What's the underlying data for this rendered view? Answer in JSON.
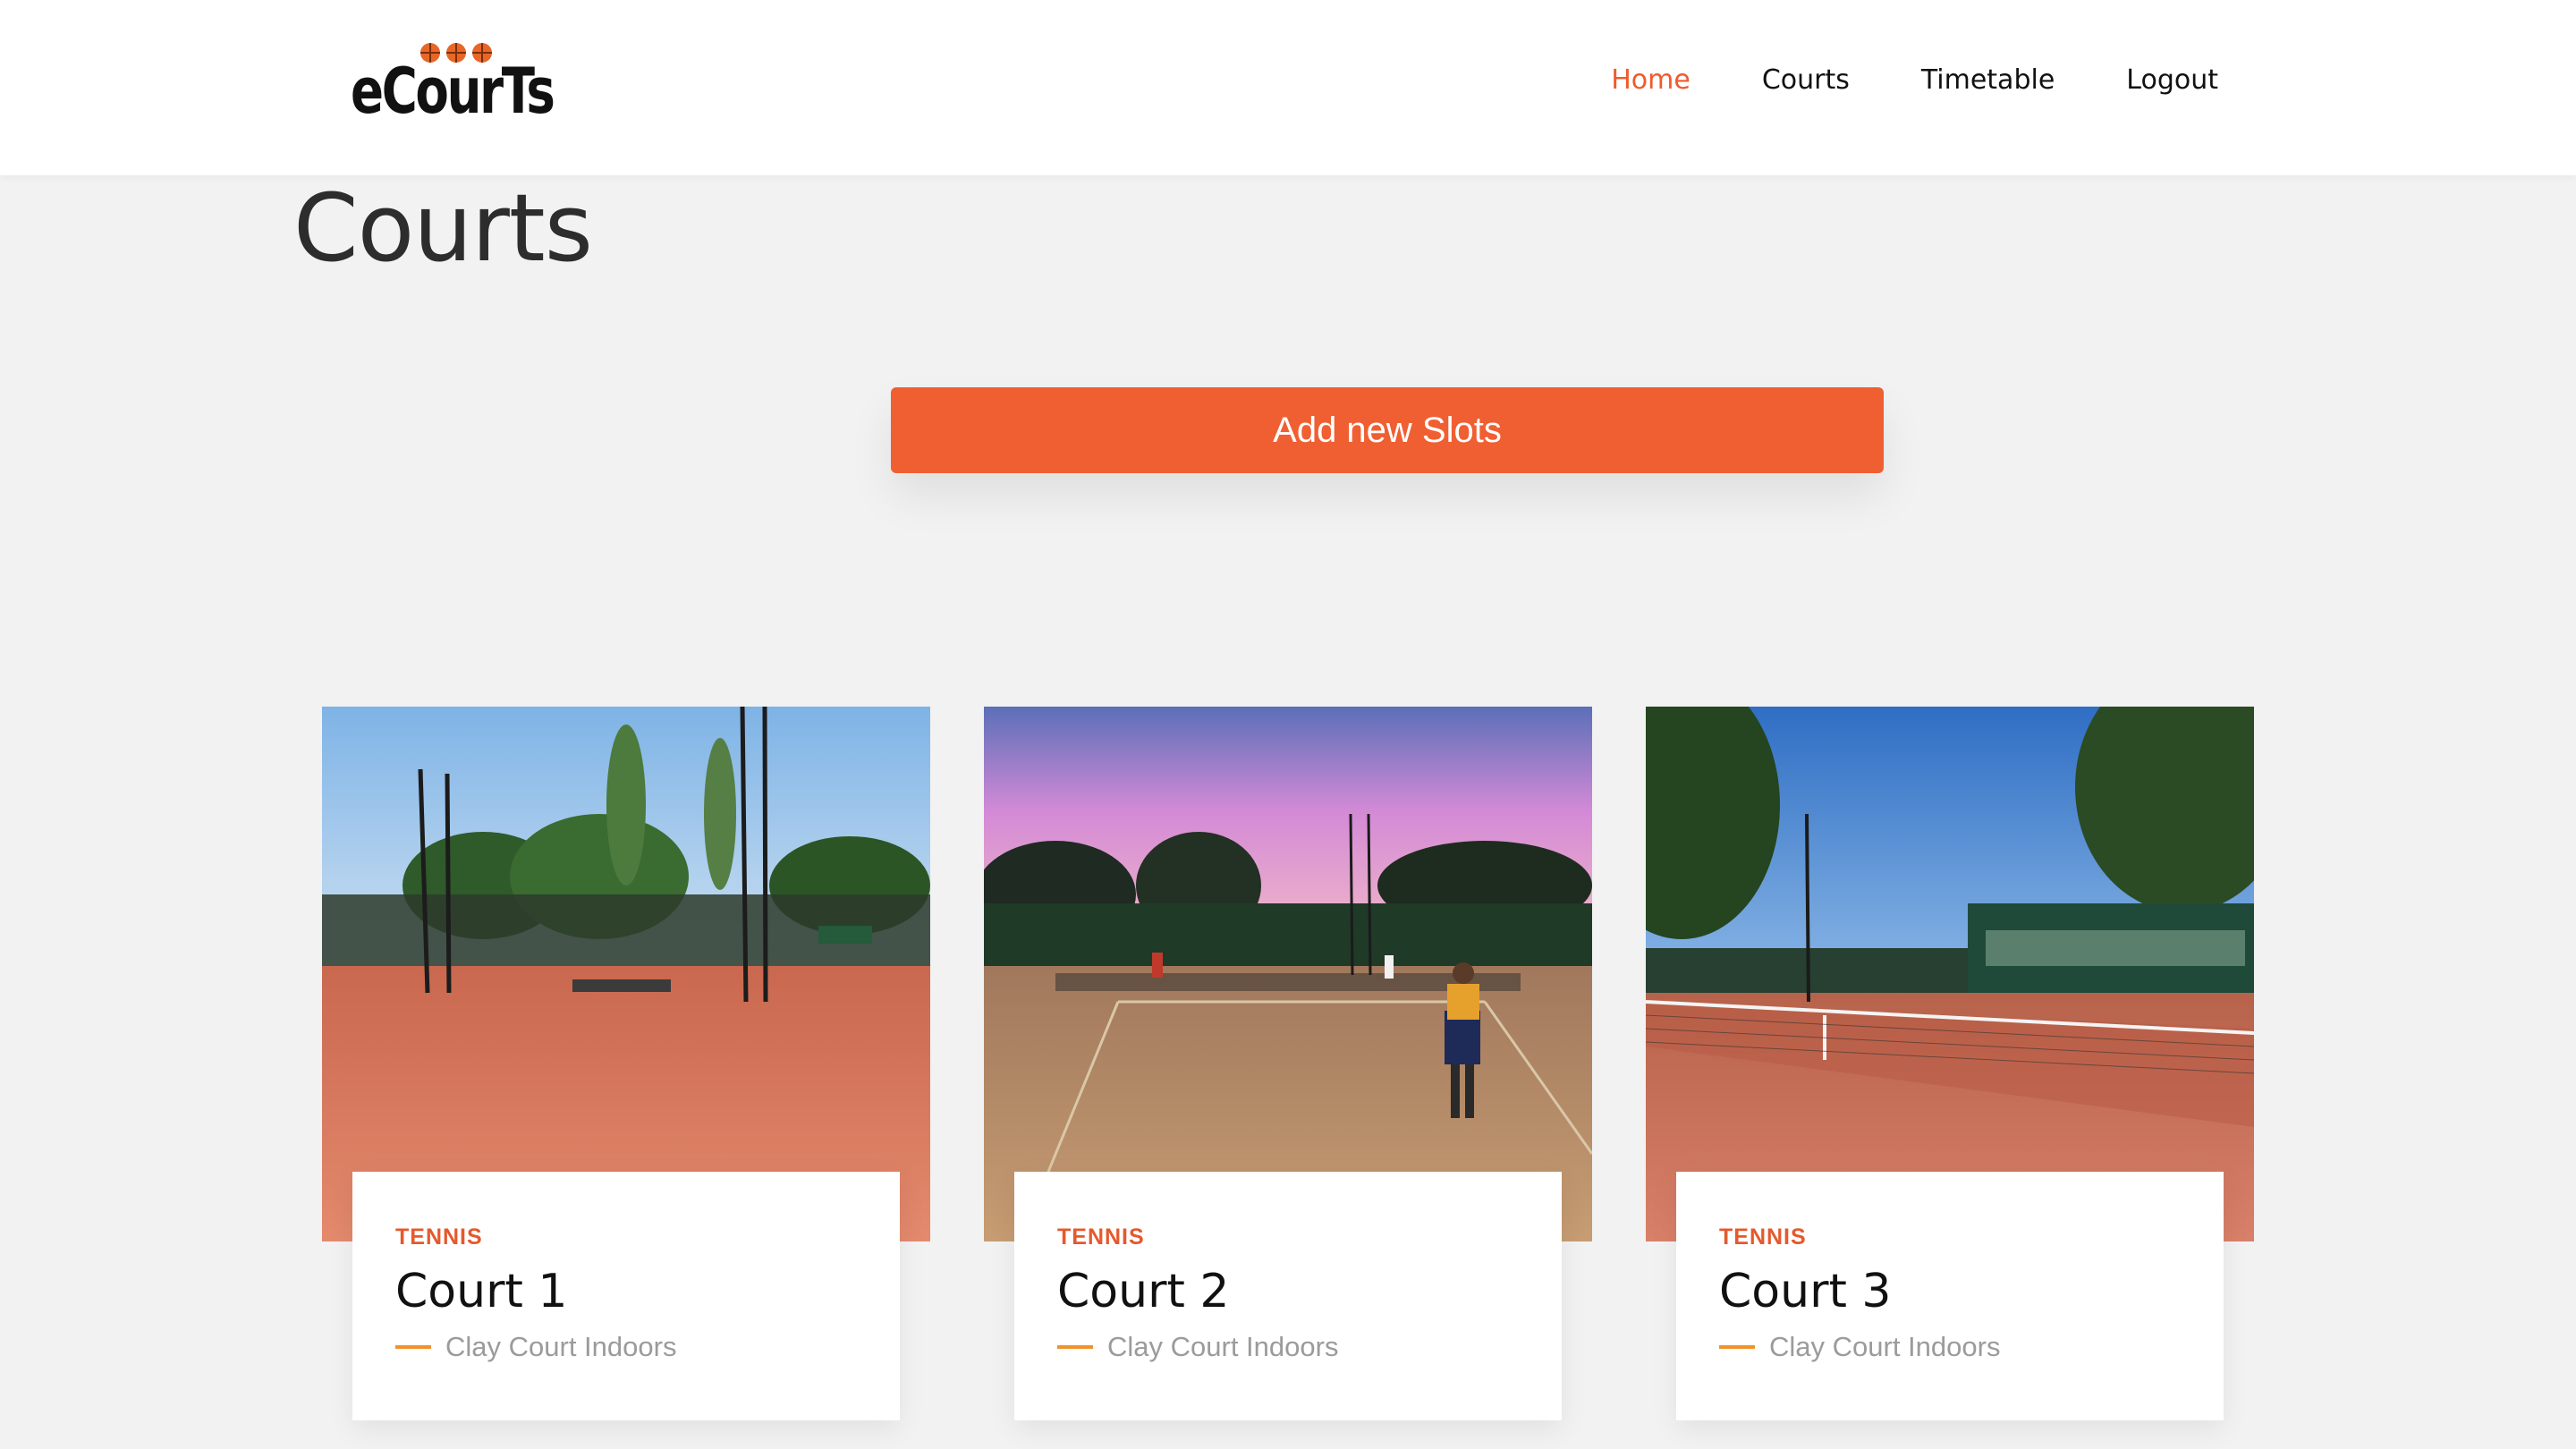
{
  "brand": {
    "logo_text": "eCourTs",
    "accent_color": "#f05f32"
  },
  "nav": {
    "items": [
      {
        "label": "Home",
        "active": true
      },
      {
        "label": "Courts",
        "active": false
      },
      {
        "label": "Timetable",
        "active": false
      },
      {
        "label": "Logout",
        "active": false
      }
    ]
  },
  "page": {
    "title": "Courts"
  },
  "actions": {
    "add_slots_label": "Add new Slots"
  },
  "courts": [
    {
      "category": "TENNIS",
      "name": "Court 1",
      "description": "Clay Court Indoors",
      "image": "clay tennis court with trees and floodlights"
    },
    {
      "category": "TENNIS",
      "name": "Court 2",
      "description": "Clay Court Indoors",
      "image": "clay tennis court at sunset with players"
    },
    {
      "category": "TENNIS",
      "name": "Court 3",
      "description": "Clay Court Indoors",
      "image": "clay tennis court with net and clubhouse"
    }
  ]
}
